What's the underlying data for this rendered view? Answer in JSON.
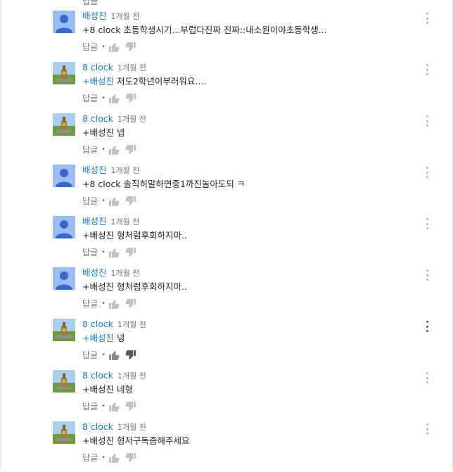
{
  "cutoff_reply_label": "답글",
  "labels": {
    "reply": "답글",
    "separator": "•"
  },
  "colors": {
    "author": "#167ac6",
    "text": "#222222",
    "meta": "#767676",
    "icon": "#c2c2c2",
    "icon_active": "#555555"
  },
  "comments": [
    {
      "author": "배성진",
      "time": "1개월 전",
      "avatar": "default-avatar",
      "mention": "",
      "text": "+8 clock 초등학생시기...부럽다진짜 진짜::내소원이야초등학생..."
    },
    {
      "author": "8 clock",
      "time": "1개월 전",
      "avatar": "clock-avatar",
      "mention": "+배성진",
      "text": " 저도2학년이부러워요...."
    },
    {
      "author": "8 clock",
      "time": "1개월 전",
      "avatar": "clock-avatar",
      "mention": "",
      "text": "+배성진 넵"
    },
    {
      "author": "배성진",
      "time": "1개월 전",
      "avatar": "default-avatar",
      "mention": "",
      "text": "+8 clock 솔직히말하면중1까진놀아도되 ㅋ"
    },
    {
      "author": "배성진",
      "time": "1개월 전",
      "avatar": "default-avatar",
      "mention": "",
      "text": "+배성진 형처럼후회하지마.."
    },
    {
      "author": "배성진",
      "time": "1개월 전",
      "avatar": "default-avatar",
      "mention": "",
      "text": "+배성진 형처럼후회하지마.."
    },
    {
      "author": "8 clock",
      "time": "1개월 전",
      "avatar": "clock-avatar",
      "mention": "+배성진",
      "text": " 넹"
    },
    {
      "author": "8 clock",
      "time": "1개월 전",
      "avatar": "clock-avatar",
      "mention": "",
      "text": "+배성진 네형"
    },
    {
      "author": "8 clock",
      "time": "1개월 전",
      "avatar": "clock-avatar",
      "mention": "",
      "text": "+배성진 형저구독좀해주세요"
    }
  ]
}
